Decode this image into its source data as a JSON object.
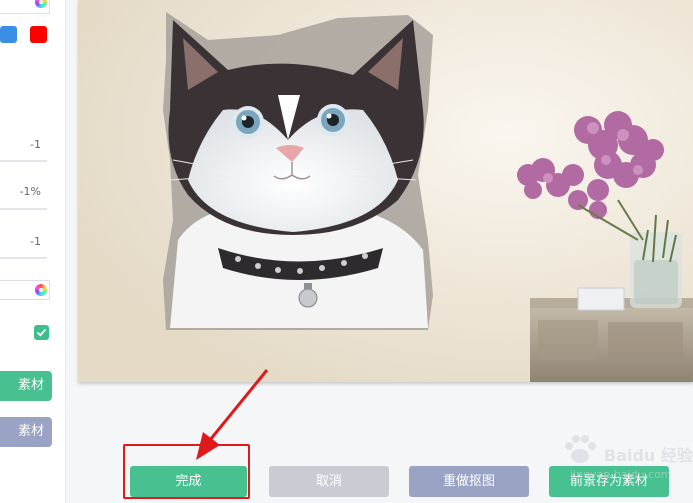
{
  "left_panel": {
    "slider_values": [
      "-1",
      "-1%",
      "-1"
    ],
    "swatch_colors": [
      "#3a8ee6",
      "#ff0000"
    ],
    "checkbox_checked": true,
    "side_buttons": [
      {
        "label": "素材",
        "color": "#46c18f"
      },
      {
        "label": "素材",
        "color": "#9aa3c4"
      }
    ]
  },
  "canvas": {
    "background_color": "#f1ebe0"
  },
  "actions": {
    "done_label": "完成",
    "cancel_label": "取消",
    "redo_label": "重做抠图",
    "save_label": "前景存为素材"
  },
  "colors": {
    "done": "#46c18f",
    "cancel": "#c9ccd3",
    "redo": "#9aa3c4",
    "save": "#46c18f",
    "annotation": "#e0191b"
  },
  "watermark": {
    "brand": "Baidu 经验",
    "sub": "jingyan.baidu.com"
  }
}
